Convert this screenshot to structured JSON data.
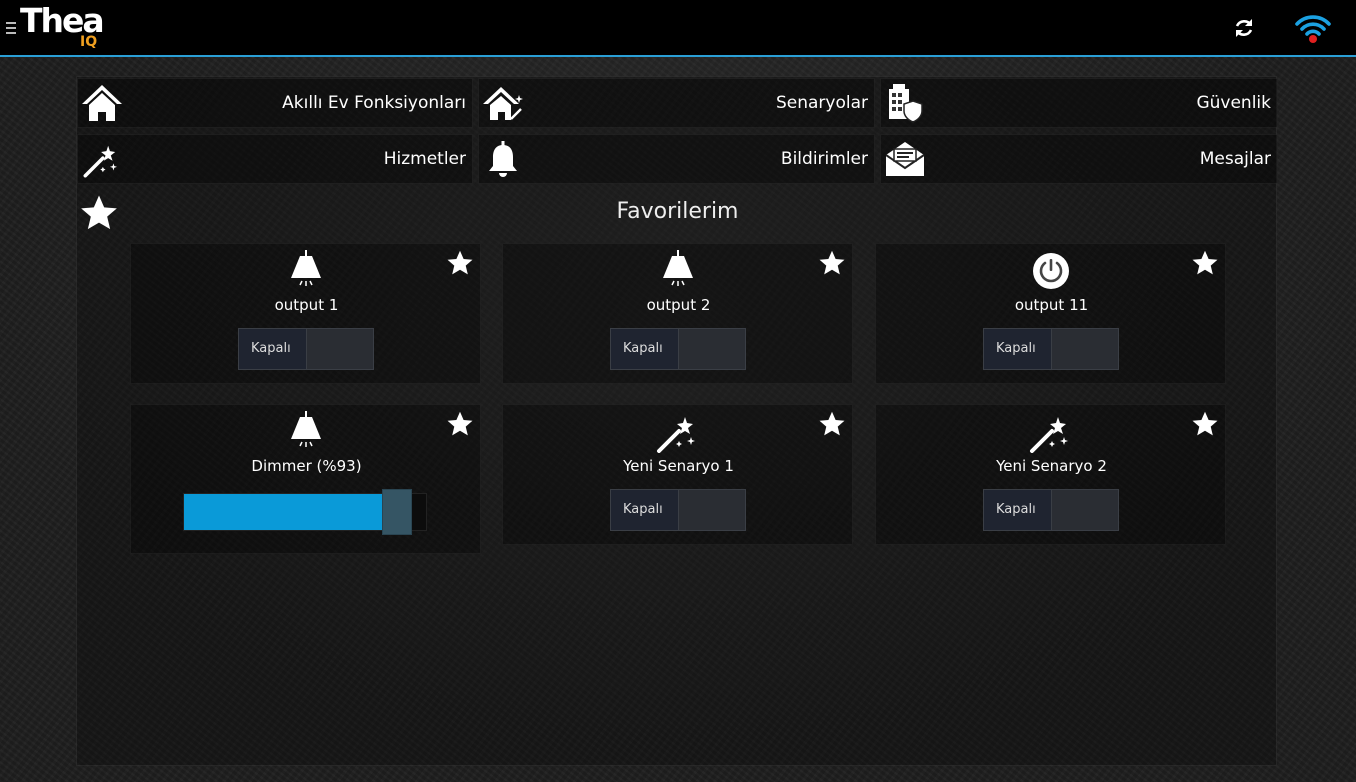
{
  "app": {
    "logo_main": "Thea",
    "logo_sub": "IQ"
  },
  "nav": [
    {
      "label": "Akıllı Ev Fonksiyonları",
      "icon": "home-icon"
    },
    {
      "label": "Senaryolar",
      "icon": "scenario-house-icon"
    },
    {
      "label": "Güvenlik",
      "icon": "security-icon"
    },
    {
      "label": "Hizmetler",
      "icon": "magic-wand-icon"
    },
    {
      "label": "Bildirimler",
      "icon": "bell-icon"
    },
    {
      "label": "Mesajlar",
      "icon": "envelope-icon"
    }
  ],
  "favorites": {
    "title": "Favorilerim",
    "cards": [
      {
        "name": "output 1",
        "icon": "lamp-icon",
        "state": "Kapalı"
      },
      {
        "name": "output 2",
        "icon": "lamp-icon",
        "state": "Kapalı"
      },
      {
        "name": "output 11",
        "icon": "power-icon",
        "state": "Kapalı"
      },
      {
        "name": "Dimmer (%93)",
        "icon": "lamp-icon",
        "dim_level": 0.93
      },
      {
        "name": "Yeni Senaryo 1",
        "icon": "magic-wand-icon",
        "state": "Kapalı"
      },
      {
        "name": "Yeni Senaryo 2",
        "icon": "magic-wand-icon",
        "state": "Kapalı"
      }
    ]
  },
  "colors": {
    "accent": "#2a9fd6",
    "slider_fill": "#0a9ad8",
    "wifi": "#1ba1e2",
    "wifi_alert": "#e02020",
    "logo_sub": "#f0a020"
  }
}
